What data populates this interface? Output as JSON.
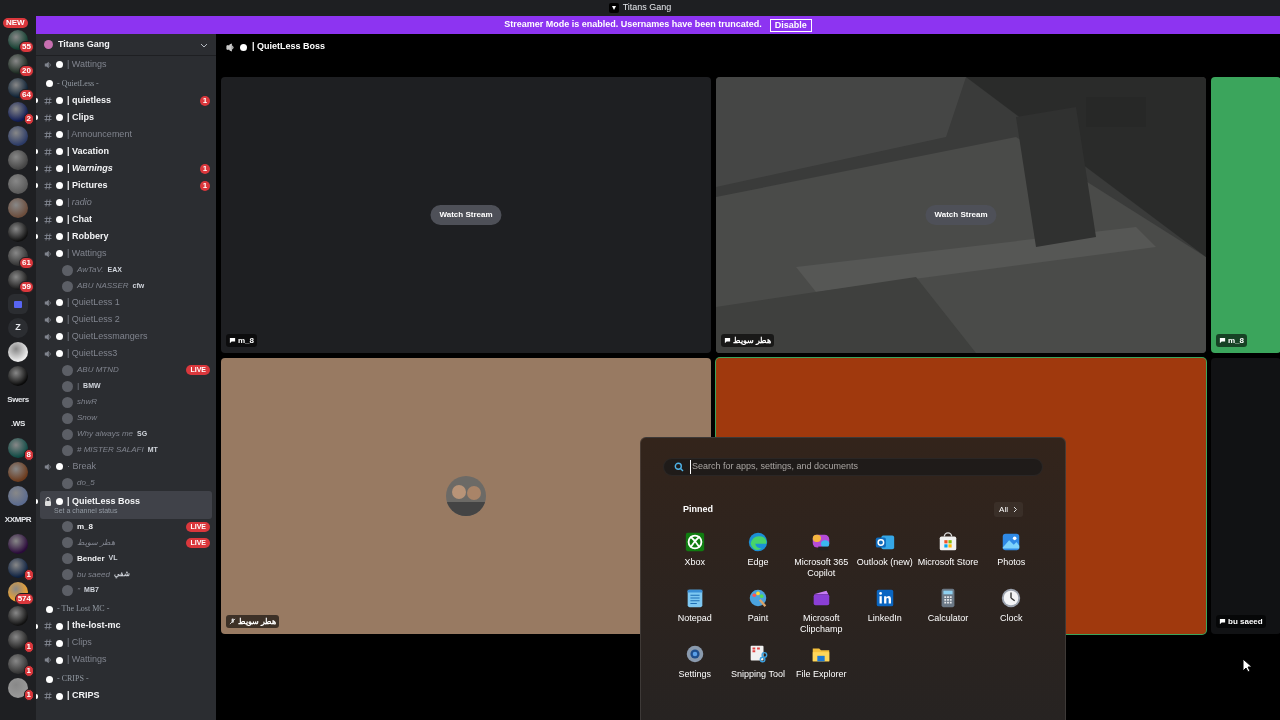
{
  "title_bar": {
    "title": "Titans Gang"
  },
  "banner": {
    "text": "Streamer Mode is enabled. Usernames have been truncated.",
    "button": "Disable"
  },
  "servers": [
    {
      "kind": "icon",
      "badge": "55"
    },
    {
      "kind": "icon",
      "badge": "20"
    },
    {
      "kind": "icon",
      "badge": "64"
    },
    {
      "kind": "icon",
      "badge": "2"
    },
    {
      "kind": "icon"
    },
    {
      "kind": "icon"
    },
    {
      "kind": "icon"
    },
    {
      "kind": "icon"
    },
    {
      "kind": "icon"
    },
    {
      "kind": "icon",
      "badge": "61"
    },
    {
      "kind": "icon",
      "badge": "59"
    },
    {
      "kind": "folder"
    },
    {
      "kind": "icon",
      "label": "Z"
    },
    {
      "kind": "icon"
    },
    {
      "kind": "icon"
    },
    {
      "kind": "icon",
      "label": "Swers"
    },
    {
      "kind": "icon",
      "label": ".WS"
    },
    {
      "kind": "icon",
      "badge": "8"
    },
    {
      "kind": "icon"
    },
    {
      "kind": "icon"
    },
    {
      "kind": "icon",
      "label": "XXMPR"
    },
    {
      "kind": "icon"
    },
    {
      "kind": "icon",
      "badge": "1"
    },
    {
      "kind": "icon",
      "badge": "574"
    },
    {
      "kind": "icon"
    },
    {
      "kind": "icon",
      "badge": "1"
    },
    {
      "kind": "icon",
      "badge": "1"
    },
    {
      "kind": "icon",
      "badge": "1"
    }
  ],
  "new_badge": "NEW",
  "server_header": {
    "name": "Titans Gang"
  },
  "channels": [
    {
      "kind": "voice",
      "name": "| Wattings",
      "unread": false
    },
    {
      "kind": "category",
      "name": "- QuietLess -"
    },
    {
      "kind": "text",
      "name": "| quietless",
      "unread": true,
      "badge": "1"
    },
    {
      "kind": "text",
      "name": "| Clips",
      "unread": true
    },
    {
      "kind": "text",
      "name": "| Announcement",
      "unread": false
    },
    {
      "kind": "text",
      "name": "| Vacation",
      "unread": true
    },
    {
      "kind": "text",
      "name": "| Warnings",
      "unread": true,
      "italic": true,
      "badge": "1"
    },
    {
      "kind": "text",
      "name": "| Pictures",
      "unread": true,
      "badge": "1"
    },
    {
      "kind": "text",
      "name": "| radio",
      "unread": false,
      "italic": true
    },
    {
      "kind": "text",
      "name": "| Chat",
      "unread": true
    },
    {
      "kind": "text",
      "name": "| Robbery",
      "unread": true
    },
    {
      "kind": "voice",
      "name": "| Wattings",
      "unread": false
    },
    {
      "kind": "member",
      "name": "AwTaV.",
      "tag": "EAX"
    },
    {
      "kind": "member",
      "name": "ABU NASSER",
      "tag": "cfw"
    },
    {
      "kind": "voice",
      "name": "| QuietLess 1",
      "unread": false
    },
    {
      "kind": "voice",
      "name": "| QuietLess 2",
      "unread": false
    },
    {
      "kind": "voice",
      "name": "| QuietLessmangers",
      "unread": false
    },
    {
      "kind": "voice",
      "name": "| QuietLess3",
      "unread": false
    },
    {
      "kind": "member",
      "name": "ABU MTND",
      "live_label": "LIVE"
    },
    {
      "kind": "member",
      "name": "|",
      "tag": "BMW"
    },
    {
      "kind": "member",
      "name": "shwR"
    },
    {
      "kind": "member",
      "name": "Snow"
    },
    {
      "kind": "member",
      "name": "Why always me",
      "tag": "SG"
    },
    {
      "kind": "member",
      "name": "# MISTER SALAFI",
      "tag": "MT"
    },
    {
      "kind": "voice",
      "name": "· Break",
      "unread": false
    },
    {
      "kind": "member",
      "name": "do_5"
    },
    {
      "kind": "voice",
      "name": "| QuietLess Boss",
      "unread": true,
      "selected": true,
      "status": "Set a channel status"
    },
    {
      "kind": "member",
      "name": "m_8",
      "live_label": "LIVE",
      "bright": true
    },
    {
      "kind": "member",
      "name": "هطر سويط",
      "live_label": "LIVE"
    },
    {
      "kind": "member",
      "name": "Bender",
      "tag": "VL",
      "bright": true
    },
    {
      "kind": "member",
      "name": "bu saeed",
      "tag": "شفي"
    },
    {
      "kind": "member",
      "name": "''",
      "tag": "MB7"
    },
    {
      "kind": "category",
      "name": "- The Lost MC -"
    },
    {
      "kind": "text",
      "name": "| the-lost-mc",
      "unread": true
    },
    {
      "kind": "text",
      "name": "| Clips",
      "unread": false
    },
    {
      "kind": "voice",
      "name": "| Wattings",
      "unread": false
    },
    {
      "kind": "category",
      "name": "- CRIPS -"
    },
    {
      "kind": "text",
      "name": "| CRIPS",
      "unread": true
    }
  ],
  "call_header": {
    "channel": "| QuietLess Boss"
  },
  "tiles": [
    {
      "kind": "stream",
      "label": "m_8",
      "button": "Watch Stream"
    },
    {
      "kind": "game",
      "label": "هطر سويط",
      "button": "Watch Stream"
    },
    {
      "kind": "color",
      "color": "#3ba55c",
      "label": "m_8"
    },
    {
      "kind": "avatar",
      "color": "#987a62",
      "label": "هطر سويط",
      "muted": true
    },
    {
      "kind": "color",
      "color": "#a0390d",
      "speaking": true
    },
    {
      "kind": "color",
      "color": "#111214",
      "label": "bu saeed"
    }
  ],
  "start_menu": {
    "search_placeholder": "Search for apps, settings, and documents",
    "pinned_title": "Pinned",
    "all_button": "All",
    "apps": [
      {
        "kind": "xbox",
        "name": "Xbox"
      },
      {
        "kind": "edge",
        "name": "Edge"
      },
      {
        "kind": "copilot",
        "name": "Microsoft 365 Copilot"
      },
      {
        "kind": "outlook",
        "name": "Outlook (new)"
      },
      {
        "kind": "store",
        "name": "Microsoft Store"
      },
      {
        "kind": "photos",
        "name": "Photos"
      },
      {
        "kind": "notepad",
        "name": "Notepad"
      },
      {
        "kind": "paint",
        "name": "Paint"
      },
      {
        "kind": "clipchamp",
        "name": "Microsoft Clipchamp"
      },
      {
        "kind": "linkedin",
        "name": "LinkedIn"
      },
      {
        "kind": "calculator",
        "name": "Calculator"
      },
      {
        "kind": "clock",
        "name": "Clock"
      },
      {
        "kind": "settings",
        "name": "Settings"
      },
      {
        "kind": "snipping",
        "name": "Snipping Tool"
      },
      {
        "kind": "explorer",
        "name": "File Explorer"
      }
    ]
  }
}
